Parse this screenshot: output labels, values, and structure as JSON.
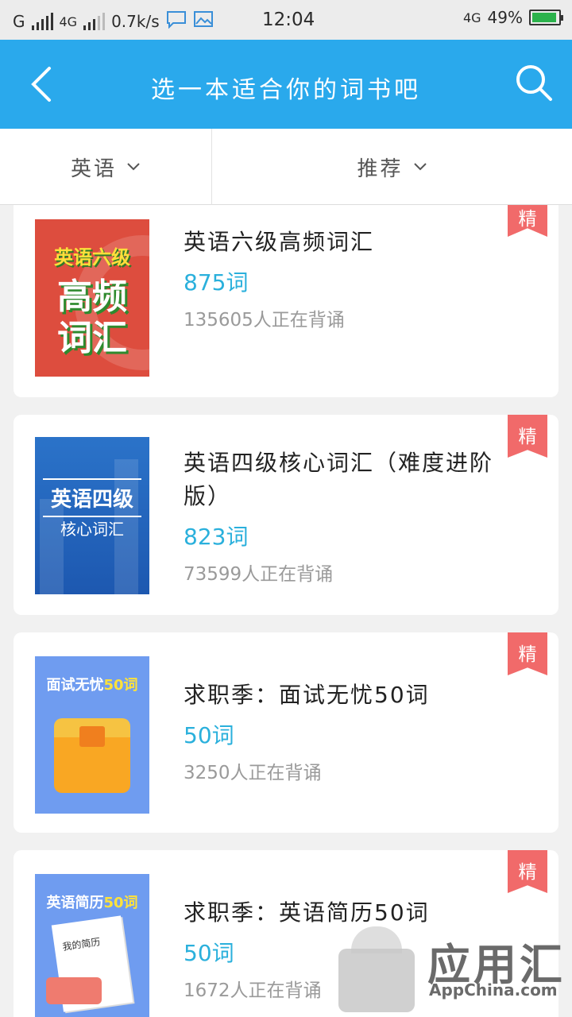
{
  "status_bar": {
    "carrier": "G",
    "network": "4G",
    "speed": "0.7k/s",
    "time": "12:04",
    "network_right": "4G",
    "battery": "49%"
  },
  "header": {
    "title": "选一本适合你的词书吧",
    "back_icon": "chevron-left-icon",
    "search_icon": "search-icon"
  },
  "filters": {
    "language": "英语",
    "sort": "推荐"
  },
  "books": [
    {
      "title": "英语六级高频词汇",
      "count": "875词",
      "learners": "135605人正在背诵",
      "badge": "精",
      "cover_line1": "英语六级",
      "cover_line2": "高频",
      "cover_line3": "词汇"
    },
    {
      "title": "英语四级核心词汇（难度进阶版）",
      "count": "823词",
      "learners": "73599人正在背诵",
      "badge": "精",
      "cover_line1": "英语四级",
      "cover_line2": "核心词汇"
    },
    {
      "title": "求职季：面试无忧50词",
      "count": "50词",
      "learners": "3250人正在背诵",
      "badge": "精",
      "cover_line1": "面试无忧",
      "cover_accent": "50词"
    },
    {
      "title": "求职季：英语简历50词",
      "count": "50词",
      "learners": "1672人正在背诵",
      "badge": "精",
      "cover_line1": "英语简历",
      "cover_accent": "50词",
      "cover_paper": "我的简历"
    }
  ],
  "watermark": {
    "name": "应用汇",
    "domain": "AppChina.com"
  },
  "colors": {
    "header": "#2aa9ec",
    "count": "#2ab0dc",
    "badge": "#f16a6a"
  }
}
